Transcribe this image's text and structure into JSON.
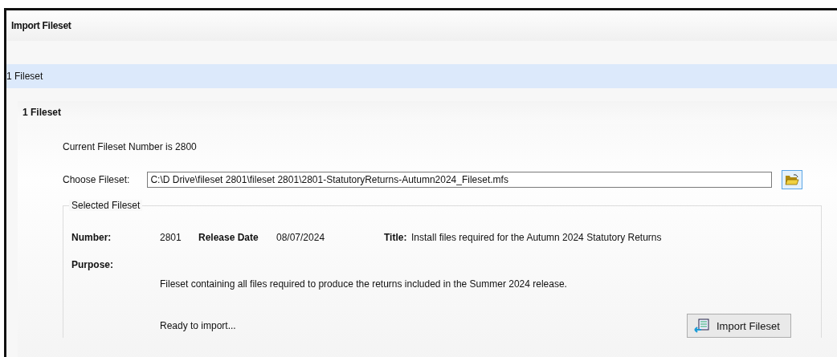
{
  "window": {
    "title": "Import Fileset"
  },
  "breadcrumb": {
    "label": "1 Fileset"
  },
  "section": {
    "title": "1 Fileset",
    "current_number": "Current Fileset Number is 2800",
    "choose": {
      "label": "Choose Fileset:",
      "value": "C:\\D Drive\\fileset 2801\\fileset 2801\\2801-StatutoryReturns-Autumn2024_Fileset.mfs"
    },
    "selected": {
      "legend": "Selected Fileset",
      "number_label": "Number:",
      "number": "2801",
      "release_label": "Release Date",
      "release": "08/07/2024",
      "title_label": "Title:",
      "title": "Install files required for the Autumn 2024 Statutory Returns",
      "purpose_label": "Purpose:",
      "purpose": "Fileset containing all files required to produce the returns included in the Summer 2024 release.",
      "status": "Ready to import...",
      "import_button": "Import Fileset"
    }
  }
}
